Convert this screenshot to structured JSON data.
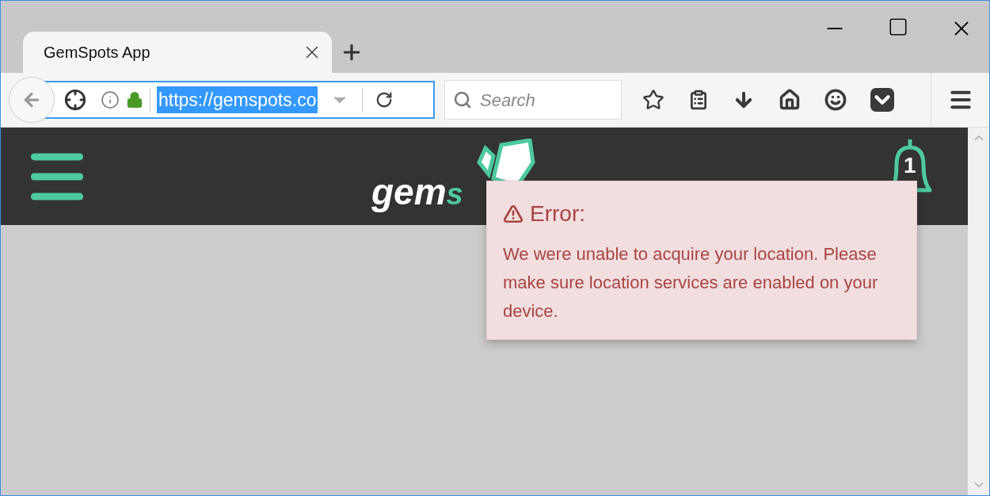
{
  "browser": {
    "tabs": [
      {
        "title": "GemSpots App",
        "selected": true
      }
    ],
    "address": {
      "url": "https://gemspots.co",
      "selected": true
    },
    "search": {
      "placeholder": "Search"
    }
  },
  "header": {
    "logo": {
      "part_1": "gem",
      "part_2": "s"
    },
    "notifications": {
      "count": "1"
    }
  },
  "error": {
    "title": "Error:",
    "message": "We were unable to acquire your location. Please make sure location services are enabled on your device."
  }
}
